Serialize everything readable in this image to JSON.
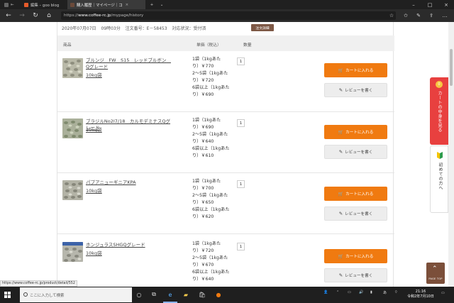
{
  "browser": {
    "tabs": [
      {
        "label": "編集 – goo blog",
        "active": false
      },
      {
        "label": "購入履歴｜マイページ｜コ",
        "active": true
      }
    ],
    "url_prefix": "https://",
    "url_host": "www.coffee-rc.jp",
    "url_path": "/mypage/history",
    "status_url": "https://www.coffee-rc.jp/product/detail/552"
  },
  "order": {
    "date": "2020年07月07日",
    "time": "09時03分",
    "order_number": "注文番号：E－58453",
    "status": "対応状況：受付済",
    "detail_button": "注文詳細"
  },
  "table_headers": {
    "product": "商品",
    "unit_price": "単価（税込）",
    "quantity": "数量"
  },
  "buttons": {
    "cart": "カートに入れる",
    "review": "レビューを書く"
  },
  "products": [
    {
      "name": "ブルンジ　FW　S15　レッドブルボン　Qグレード",
      "size": "10kg袋",
      "price_lines": [
        "1袋（1kgあた",
        "り）￥770",
        "2〜5袋（1kgあた",
        "り）￥720",
        "6袋以上（1kgあた",
        "り）￥690"
      ],
      "qty": "1"
    },
    {
      "name": "ブラジルNo2I7/18　カルモデミナスQグレード",
      "size": "10kg袋",
      "price_lines": [
        "1袋（1kgあた",
        "り）￥690",
        "2〜5袋（1kgあた",
        "り）￥640",
        "6袋以上（1kgあた",
        "り）￥610"
      ],
      "qty": "1"
    },
    {
      "name": "パプアニューギニアKPA",
      "size": "10kg袋",
      "price_lines": [
        "1袋（1kgあた",
        "り）￥700",
        "2〜5袋（1kgあた",
        "り）￥650",
        "6袋以上（1kgあた",
        "り）￥620"
      ],
      "qty": "1"
    },
    {
      "name": "ホンジュラスSHGQグレード",
      "size": "10kg袋",
      "price_lines": [
        "1袋（1kgあた",
        "り）￥720",
        "2〜5袋（1kgあた",
        "り）￥670",
        "6袋以上（1kgあた",
        "り）￥640"
      ],
      "qty": "1"
    }
  ],
  "side": {
    "cart_label": "カートの中身を見る",
    "cart_count": "0",
    "first_label": "初めての方へ"
  },
  "page_top": "PAGE TOP",
  "taskbar": {
    "search_placeholder": "ここに入力して検索",
    "time": "21:16",
    "date": "令和2年7月10日"
  },
  "colors": {
    "accent_orange": "#f07a10",
    "brown": "#7d5845",
    "side_red": "#e8403f"
  }
}
